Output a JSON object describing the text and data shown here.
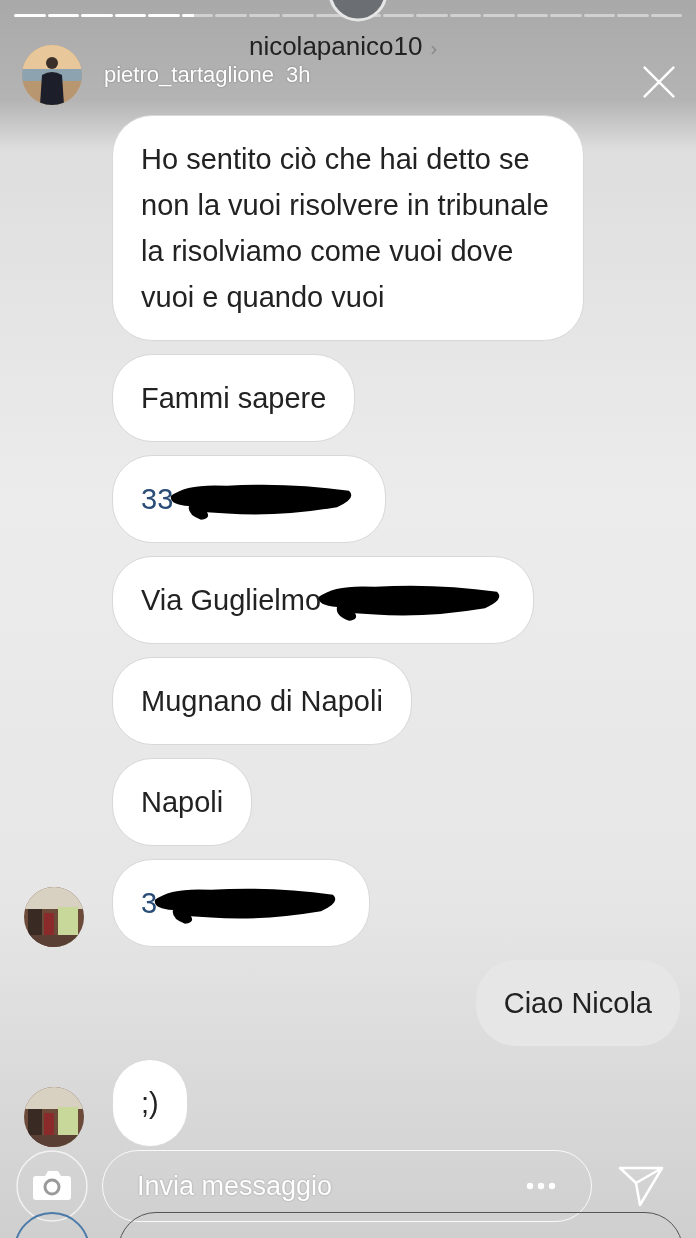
{
  "story": {
    "segments": [
      {
        "viewed": true
      },
      {
        "viewed": true
      },
      {
        "viewed": true
      },
      {
        "viewed": true
      },
      {
        "viewed": true
      },
      {
        "viewed": false,
        "level": 0.4
      },
      {
        "viewed": false
      },
      {
        "viewed": false
      },
      {
        "viewed": false
      },
      {
        "viewed": false
      },
      {
        "viewed": false
      },
      {
        "viewed": false
      },
      {
        "viewed": false
      },
      {
        "viewed": false
      },
      {
        "viewed": false
      },
      {
        "viewed": false
      },
      {
        "viewed": false
      },
      {
        "viewed": false
      },
      {
        "viewed": false
      },
      {
        "viewed": false
      }
    ],
    "poster": "pietro_tartaglione",
    "time": "3h"
  },
  "chat": {
    "title": "nicolapanico10",
    "chevron": "›",
    "messages": [
      {
        "outgoing": false,
        "kind": "text",
        "text": "Ho sentito ciò che hai detto se non la vuoi risolvere in tribunale la risolviamo come vuoi dove vuoi e quando vuoi",
        "redacted": false,
        "avatar": false
      },
      {
        "outgoing": false,
        "kind": "text",
        "text": "Fammi sapere",
        "redacted": false,
        "avatar": false
      },
      {
        "outgoing": false,
        "kind": "link",
        "text": "33",
        "redacted": true,
        "avatar": false
      },
      {
        "outgoing": false,
        "kind": "text",
        "text": "Via Guglielmo",
        "redacted": true,
        "avatar": false
      },
      {
        "outgoing": false,
        "kind": "text",
        "text": "Mugnano di Napoli",
        "redacted": false,
        "avatar": false
      },
      {
        "outgoing": false,
        "kind": "text",
        "text": "Napoli",
        "redacted": false,
        "avatar": false
      },
      {
        "outgoing": false,
        "kind": "link",
        "text": "3",
        "redacted": true,
        "avatar": true
      },
      {
        "outgoing": true,
        "kind": "text",
        "text": "Ciao Nicola",
        "redacted": false,
        "avatar": false
      },
      {
        "outgoing": false,
        "kind": "text",
        "text": ";)",
        "redacted": false,
        "avatar": true
      }
    ]
  },
  "reply": {
    "placeholder": "Invia messaggio"
  }
}
